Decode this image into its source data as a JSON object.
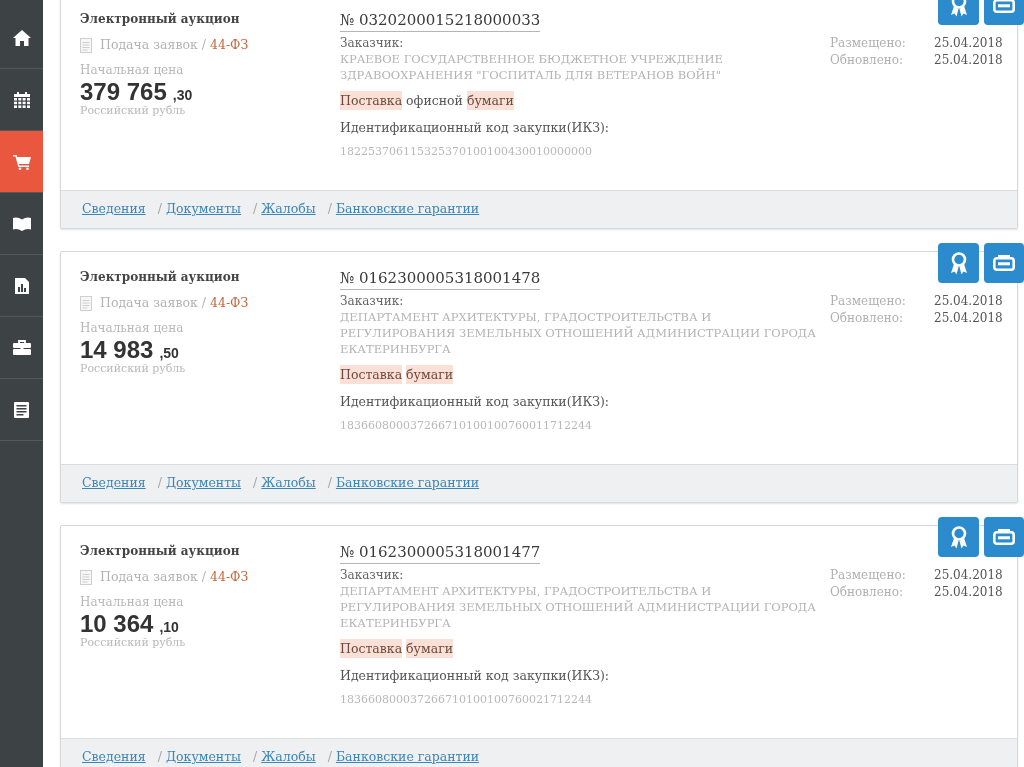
{
  "sidebar": {
    "items": [
      {
        "selected": false
      },
      {
        "selected": false
      },
      {
        "selected": true
      },
      {
        "selected": false
      },
      {
        "selected": false
      },
      {
        "selected": false
      },
      {
        "selected": false
      }
    ]
  },
  "cards": [
    {
      "procedure_type": "Электронный аукцион",
      "stage": "Подача заявок /",
      "law": "44-ФЗ",
      "price_label": "Начальная цена",
      "price_whole": "379 765",
      "price_fraction": ",30",
      "currency": "Российский рубль",
      "number": "№ 0320200015218000033",
      "customer_label": "Заказчик:",
      "customer": "КРАЕВОЕ ГОСУДАРСТВЕННОЕ БЮДЖЕТНОЕ УЧРЕЖДЕНИЕ ЗДРАВООХРАНЕНИЯ \"ГОСПИТАЛЬ ДЛЯ ВЕТЕРАНОВ ВОЙН\"",
      "subject": [
        {
          "text": "Поставка",
          "highlighted": true
        },
        {
          "text": "офисной",
          "highlighted": false
        },
        {
          "text": "бумаги",
          "highlighted": true
        }
      ],
      "ikz_label": "Идентификационный код закупки(ИКЗ):",
      "ikz": "182253706115325370100100430010000000",
      "dates": [
        {
          "label": "Размещено:",
          "value": "25.04.2018"
        },
        {
          "label": "Обновлено:",
          "value": "25.04.2018"
        }
      ],
      "links": [
        {
          "label": "Сведения"
        },
        {
          "separator": "/",
          "label": "Документы"
        },
        {
          "separator": "/",
          "label": "Жалобы"
        },
        {
          "separator": "/",
          "label": "Банковские гарантии"
        }
      ]
    },
    {
      "procedure_type": "Электронный аукцион",
      "stage": "Подача заявок /",
      "law": "44-ФЗ",
      "price_label": "Начальная цена",
      "price_whole": "14 983",
      "price_fraction": ",50",
      "currency": "Российский рубль",
      "number": "№ 0162300005318001478",
      "customer_label": "Заказчик:",
      "customer": "ДЕПАРТАМЕНТ АРХИТЕКТУРЫ, ГРАДОСТРОИТЕЛЬСТВА И РЕГУЛИРОВАНИЯ ЗЕМЕЛЬНЫХ ОТНОШЕНИЙ АДМИНИСТРАЦИИ ГОРОДА ЕКАТЕРИНБУРГА",
      "subject": [
        {
          "text": "Поставка",
          "highlighted": true
        },
        {
          "text": "бумаги",
          "highlighted": true
        }
      ],
      "ikz_label": "Идентификационный код закупки(ИКЗ):",
      "ikz": "183660800037266710100100760011712244",
      "dates": [
        {
          "label": "Размещено:",
          "value": "25.04.2018"
        },
        {
          "label": "Обновлено:",
          "value": "25.04.2018"
        }
      ],
      "links": [
        {
          "label": "Сведения"
        },
        {
          "separator": "/",
          "label": "Документы"
        },
        {
          "separator": "/",
          "label": "Жалобы"
        },
        {
          "separator": "/",
          "label": "Банковские гарантии"
        }
      ]
    },
    {
      "procedure_type": "Электронный аукцион",
      "stage": "Подача заявок /",
      "law": "44-ФЗ",
      "price_label": "Начальная цена",
      "price_whole": "10 364",
      "price_fraction": ",10",
      "currency": "Российский рубль",
      "number": "№ 0162300005318001477",
      "customer_label": "Заказчик:",
      "customer": "ДЕПАРТАМЕНТ АРХИТЕКТУРЫ, ГРАДОСТРОИТЕЛЬСТВА И РЕГУЛИРОВАНИЯ ЗЕМЕЛЬНЫХ ОТНОШЕНИЙ АДМИНИСТРАЦИИ ГОРОДА ЕКАТЕРИНБУРГА",
      "subject": [
        {
          "text": "Поставка",
          "highlighted": true
        },
        {
          "text": "бумаги",
          "highlighted": true
        }
      ],
      "ikz_label": "Идентификационный код закупки(ИКЗ):",
      "ikz": "183660800037266710100100760021712244",
      "dates": [
        {
          "label": "Размещено:",
          "value": "25.04.2018"
        },
        {
          "label": "Обновлено:",
          "value": "25.04.2018"
        }
      ],
      "links": [
        {
          "label": "Сведения"
        },
        {
          "separator": "/",
          "label": "Документы"
        },
        {
          "separator": "/",
          "label": "Жалобы"
        },
        {
          "separator": "/",
          "label": "Банковские гарантии"
        }
      ]
    }
  ]
}
